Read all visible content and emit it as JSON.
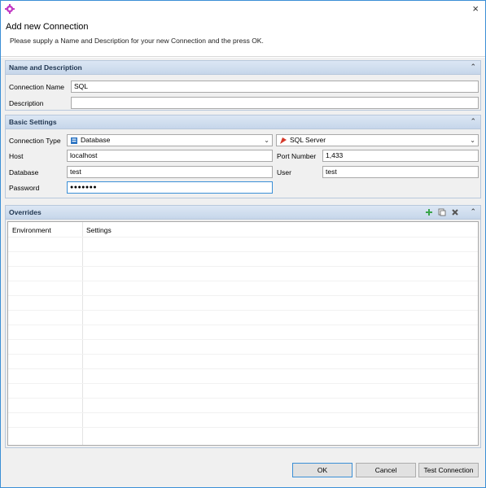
{
  "window": {
    "close_glyph": "×",
    "app_icon": "gear-icon"
  },
  "header": {
    "title": "Add new Connection",
    "description": "Please supply a Name and Description for your new Connection and the press OK."
  },
  "name_section": {
    "title": "Name and Description",
    "connection_name_label": "Connection Name",
    "connection_name_value": "SQL",
    "description_label": "Description",
    "description_value": ""
  },
  "basic_section": {
    "title": "Basic Settings",
    "connection_type_label": "Connection Type",
    "connection_type_value": "Database",
    "driver_value": "SQL Server",
    "host_label": "Host",
    "host_value": "localhost",
    "port_label": "Port Number",
    "port_value": "1,433",
    "database_label": "Database",
    "database_value": "test",
    "user_label": "User",
    "user_value": "test",
    "password_label": "Password",
    "password_value": "●●●●●●●"
  },
  "overrides_section": {
    "title": "Overrides",
    "columns": [
      "Environment",
      "Settings"
    ]
  },
  "buttons": {
    "ok": "OK",
    "cancel": "Cancel",
    "test": "Test Connection"
  },
  "colors": {
    "accent": "#3b8fd6",
    "section_header": "#c6d6ea",
    "add_icon": "#3aa54a",
    "delete_icon": "#555555"
  }
}
